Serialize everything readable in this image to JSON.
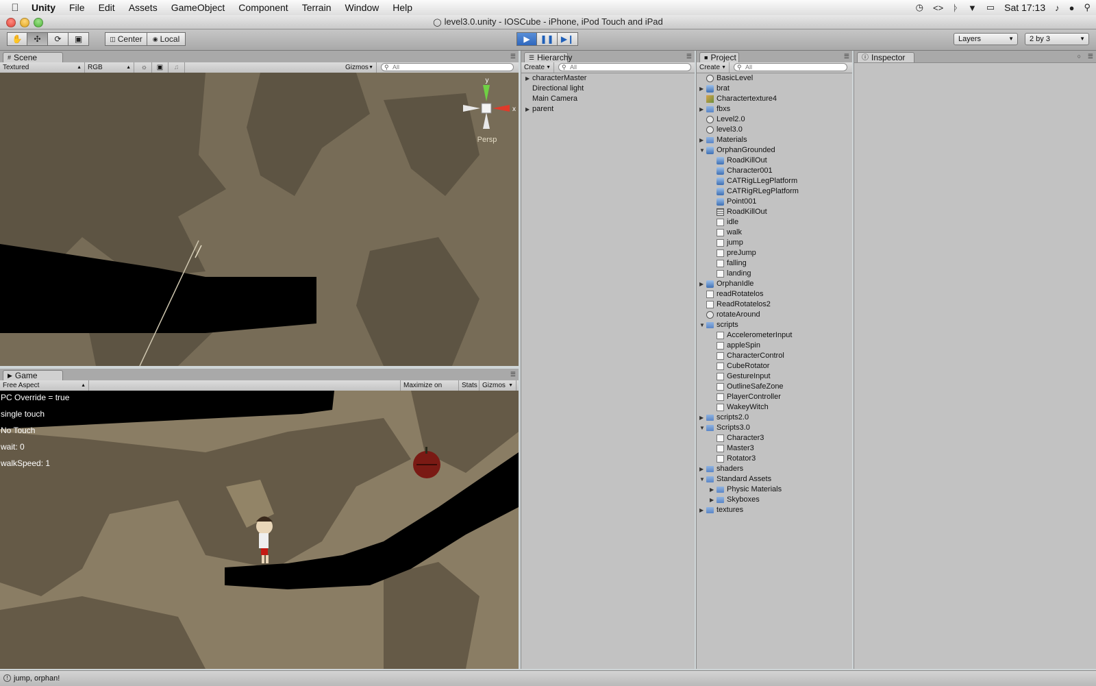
{
  "menubar": {
    "app": "Unity",
    "items": [
      "File",
      "Edit",
      "Assets",
      "GameObject",
      "Component",
      "Terrain",
      "Window",
      "Help"
    ],
    "clock": "Sat 17:13"
  },
  "window": {
    "title": "level3.0.unity - IOSCube - iPhone, iPod Touch and iPad"
  },
  "toolbar": {
    "pivot": "Center",
    "space": "Local",
    "layers": "Layers",
    "layout": "2 by 3"
  },
  "scene": {
    "tab": "Scene",
    "render_mode": "Textured",
    "color_mode": "RGB",
    "gizmos": "Gizmos",
    "search_placeholder": "All",
    "projection": "Persp",
    "axis_x": "x",
    "axis_y": "y"
  },
  "game": {
    "tab": "Game",
    "aspect": "Free Aspect",
    "maximize": "Maximize on Play",
    "stats": "Stats",
    "gizmos": "Gizmos",
    "overlay": [
      "PC Override = true",
      "single touch",
      "No Touch",
      "wait: 0",
      "walkSpeed: 1"
    ]
  },
  "hierarchy": {
    "tab": "Hierarchy",
    "create": "Create",
    "search_placeholder": "All",
    "items": [
      {
        "label": "characterMaster",
        "expandable": true
      },
      {
        "label": "Directional light",
        "expandable": false
      },
      {
        "label": "Main Camera",
        "expandable": false
      },
      {
        "label": "parent",
        "expandable": true
      }
    ]
  },
  "project": {
    "tab": "Project",
    "create": "Create",
    "search_placeholder": "All",
    "items": [
      {
        "label": "BasicLevel",
        "depth": 0,
        "icon": "scene",
        "tri": ""
      },
      {
        "label": "brat",
        "depth": 0,
        "icon": "prefab",
        "tri": "collapsed"
      },
      {
        "label": "Charactertexture4",
        "depth": 0,
        "icon": "texture",
        "tri": ""
      },
      {
        "label": "fbxs",
        "depth": 0,
        "icon": "folder",
        "tri": "collapsed"
      },
      {
        "label": "Level2.0",
        "depth": 0,
        "icon": "scene",
        "tri": ""
      },
      {
        "label": "level3.0",
        "depth": 0,
        "icon": "scene",
        "tri": ""
      },
      {
        "label": "Materials",
        "depth": 0,
        "icon": "folder",
        "tri": "collapsed"
      },
      {
        "label": "OrphanGrounded",
        "depth": 0,
        "icon": "prefab",
        "tri": "expanded"
      },
      {
        "label": "RoadKillOut",
        "depth": 1,
        "icon": "prefab",
        "tri": ""
      },
      {
        "label": "Character001",
        "depth": 1,
        "icon": "prefab",
        "tri": ""
      },
      {
        "label": "CATRigLLegPlatform",
        "depth": 1,
        "icon": "prefab",
        "tri": ""
      },
      {
        "label": "CATRigRLegPlatform",
        "depth": 1,
        "icon": "prefab",
        "tri": ""
      },
      {
        "label": "Point001",
        "depth": 1,
        "icon": "prefab",
        "tri": ""
      },
      {
        "label": "RoadKillOut",
        "depth": 1,
        "icon": "mesh",
        "tri": ""
      },
      {
        "label": "idle",
        "depth": 1,
        "icon": "script",
        "tri": ""
      },
      {
        "label": "walk",
        "depth": 1,
        "icon": "script",
        "tri": ""
      },
      {
        "label": "jump",
        "depth": 1,
        "icon": "script",
        "tri": ""
      },
      {
        "label": "preJump",
        "depth": 1,
        "icon": "script",
        "tri": ""
      },
      {
        "label": "falling",
        "depth": 1,
        "icon": "script",
        "tri": ""
      },
      {
        "label": "landing",
        "depth": 1,
        "icon": "script",
        "tri": ""
      },
      {
        "label": "OrphanIdle",
        "depth": 0,
        "icon": "prefab",
        "tri": "collapsed"
      },
      {
        "label": "readRotatelos",
        "depth": 0,
        "icon": "script",
        "tri": ""
      },
      {
        "label": "ReadRotatelos2",
        "depth": 0,
        "icon": "script",
        "tri": ""
      },
      {
        "label": "rotateAround",
        "depth": 0,
        "icon": "scene",
        "tri": ""
      },
      {
        "label": "scripts",
        "depth": 0,
        "icon": "folder",
        "tri": "expanded"
      },
      {
        "label": "AccelerometerInput",
        "depth": 1,
        "icon": "script",
        "tri": ""
      },
      {
        "label": "appleSpin",
        "depth": 1,
        "icon": "script",
        "tri": ""
      },
      {
        "label": "CharacterControl",
        "depth": 1,
        "icon": "script",
        "tri": ""
      },
      {
        "label": "CubeRotator",
        "depth": 1,
        "icon": "script",
        "tri": ""
      },
      {
        "label": "GestureInput",
        "depth": 1,
        "icon": "script",
        "tri": ""
      },
      {
        "label": "OutlineSafeZone",
        "depth": 1,
        "icon": "script",
        "tri": ""
      },
      {
        "label": "PlayerController",
        "depth": 1,
        "icon": "script",
        "tri": ""
      },
      {
        "label": "WakeyWitch",
        "depth": 1,
        "icon": "script",
        "tri": ""
      },
      {
        "label": "scripts2.0",
        "depth": 0,
        "icon": "folder",
        "tri": "collapsed"
      },
      {
        "label": "Scripts3.0",
        "depth": 0,
        "icon": "folder",
        "tri": "expanded"
      },
      {
        "label": "Character3",
        "depth": 1,
        "icon": "script",
        "tri": ""
      },
      {
        "label": "Master3",
        "depth": 1,
        "icon": "script",
        "tri": ""
      },
      {
        "label": "Rotator3",
        "depth": 1,
        "icon": "script",
        "tri": ""
      },
      {
        "label": "shaders",
        "depth": 0,
        "icon": "folder",
        "tri": "collapsed"
      },
      {
        "label": "Standard Assets",
        "depth": 0,
        "icon": "folder",
        "tri": "expanded"
      },
      {
        "label": "Physic Materials",
        "depth": 1,
        "icon": "folder",
        "tri": "collapsed"
      },
      {
        "label": "Skyboxes",
        "depth": 1,
        "icon": "folder",
        "tri": "collapsed"
      },
      {
        "label": "textures",
        "depth": 0,
        "icon": "folder",
        "tri": "collapsed"
      }
    ]
  },
  "inspector": {
    "tab": "Inspector"
  },
  "status": {
    "message": "jump, orphan!"
  },
  "colors": {
    "play_blue": "#2f67bd",
    "panel": "#c2c2c2",
    "viewport": "#7b705b"
  }
}
